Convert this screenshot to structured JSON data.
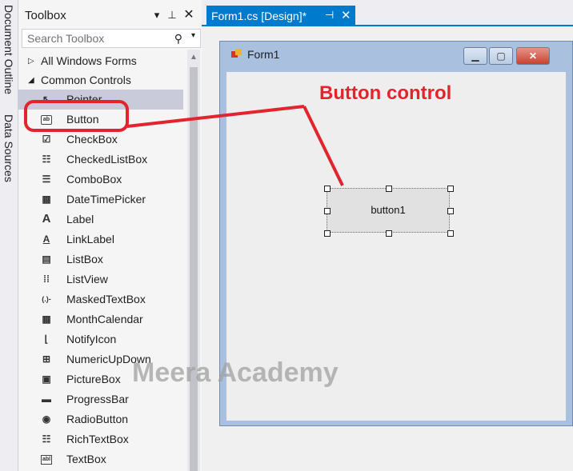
{
  "side_tabs": [
    "Document Outline",
    "Data Sources"
  ],
  "toolbox": {
    "title": "Toolbox",
    "search_placeholder": "Search Toolbox",
    "groups": [
      {
        "label": "All Windows Forms",
        "expanded": false
      },
      {
        "label": "Common Controls",
        "expanded": true
      }
    ],
    "items": [
      {
        "label": "Pointer",
        "icon": "pointer-icon"
      },
      {
        "label": "Button",
        "icon": "button-icon"
      },
      {
        "label": "CheckBox",
        "icon": "checkbox-icon"
      },
      {
        "label": "CheckedListBox",
        "icon": "checkedlistbox-icon"
      },
      {
        "label": "ComboBox",
        "icon": "combobox-icon"
      },
      {
        "label": "DateTimePicker",
        "icon": "datetimepicker-icon"
      },
      {
        "label": "Label",
        "icon": "label-icon"
      },
      {
        "label": "LinkLabel",
        "icon": "linklabel-icon"
      },
      {
        "label": "ListBox",
        "icon": "listbox-icon"
      },
      {
        "label": "ListView",
        "icon": "listview-icon"
      },
      {
        "label": "MaskedTextBox",
        "icon": "maskedtextbox-icon"
      },
      {
        "label": "MonthCalendar",
        "icon": "monthcalendar-icon"
      },
      {
        "label": "NotifyIcon",
        "icon": "notifyicon-icon"
      },
      {
        "label": "NumericUpDown",
        "icon": "numericupdown-icon"
      },
      {
        "label": "PictureBox",
        "icon": "picturebox-icon"
      },
      {
        "label": "ProgressBar",
        "icon": "progressbar-icon"
      },
      {
        "label": "RadioButton",
        "icon": "radiobutton-icon"
      },
      {
        "label": "RichTextBox",
        "icon": "richtextbox-icon"
      },
      {
        "label": "TextBox",
        "icon": "textbox-icon"
      }
    ]
  },
  "document_tab": {
    "title": "Form1.cs [Design]*"
  },
  "form": {
    "title": "Form1",
    "button_text": "button1"
  },
  "annotation": {
    "text": "Button control",
    "color": "#e1242d"
  },
  "watermark": "Meera Academy",
  "colors": {
    "accent": "#007acc",
    "selection": "#c9cbda"
  }
}
